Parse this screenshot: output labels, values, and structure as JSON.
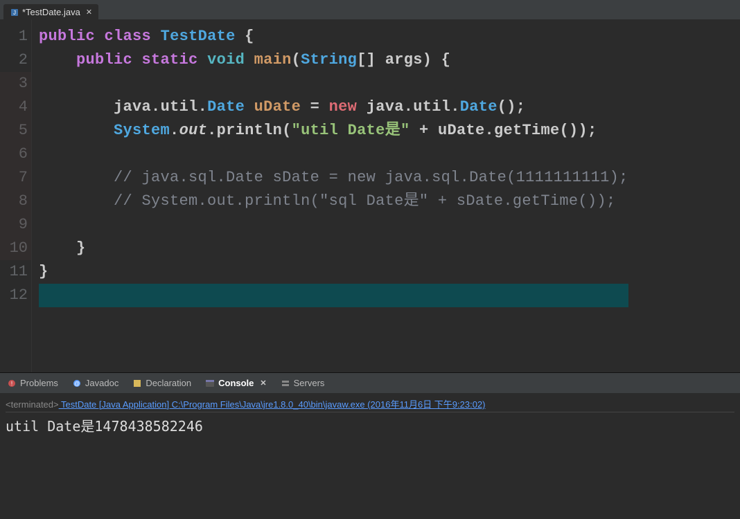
{
  "tab": {
    "name": "*TestDate.java"
  },
  "code": {
    "lines": [
      1,
      2,
      3,
      4,
      5,
      6,
      7,
      8,
      9,
      10,
      11,
      12
    ],
    "tokens": {
      "public": "public",
      "class": "class",
      "className": "TestDate",
      "static": "static",
      "void": "void",
      "main": "main",
      "String": "String",
      "args": "args",
      "java": "java",
      "util": "util",
      "Date": "Date",
      "uDate": "uDate",
      "new": "new",
      "System": "System",
      "out": "out",
      "println": "println",
      "str1": "\"util Date是\"",
      "getTime": "getTime",
      "cmt1": "// java.sql.Date sDate = new java.sql.Date(1111111111);",
      "cmt2": "// System.out.println(\"sql Date是\" + sDate.getTime());",
      "braceO": "{",
      "braceC": "}",
      "parenO": "(",
      "parenC": ")",
      "brackO": "[",
      "brackC": "]",
      "eq": " = ",
      "plus": " + ",
      "dot": ".",
      "semi": ";",
      "emptyParens": "()"
    }
  },
  "views": {
    "problems": "Problems",
    "javadoc": "Javadoc",
    "declaration": "Declaration",
    "console": "Console",
    "servers": "Servers"
  },
  "console": {
    "terminated": "<terminated>",
    "runInfo": " TestDate [Java Application] C:\\Program Files\\Java\\jre1.8.0_40\\bin\\javaw.exe (2016年11月6日 下午9:23:02)",
    "output": "util Date是1478438582246"
  }
}
